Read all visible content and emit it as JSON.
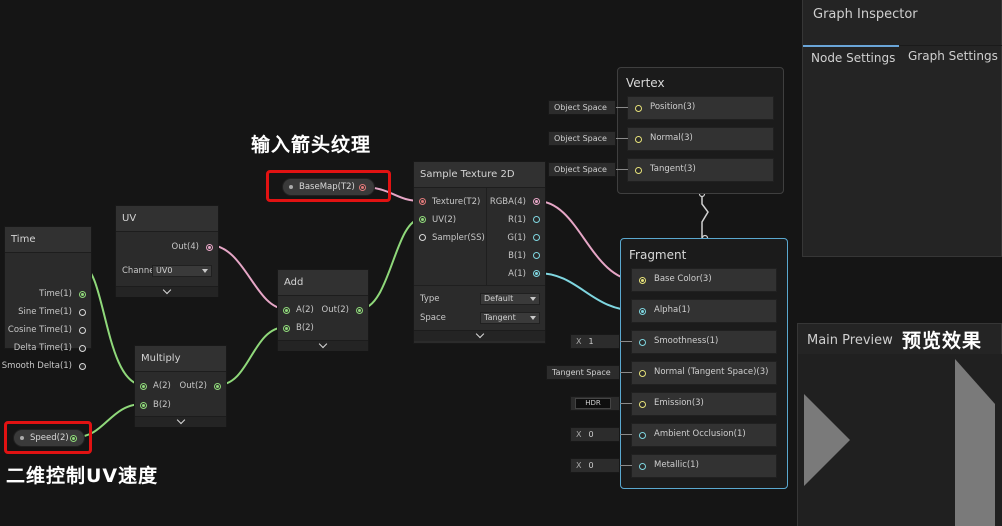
{
  "nodes": {
    "time": {
      "title": "Time",
      "outputs": [
        "Time(1)",
        "Sine Time(1)",
        "Cosine Time(1)",
        "Delta Time(1)",
        "Smooth Delta(1)"
      ]
    },
    "uv": {
      "title": "UV",
      "output": "Out(4)",
      "channel_label": "Channe",
      "channel_value": "UV0"
    },
    "multiply": {
      "title": "Multiply",
      "inputs": [
        "A(2)",
        "B(2)"
      ],
      "output": "Out(2)"
    },
    "add": {
      "title": "Add",
      "inputs": [
        "A(2)",
        "B(2)"
      ],
      "output": "Out(2)"
    },
    "sample": {
      "title": "Sample Texture 2D",
      "inputs": [
        "Texture(T2)",
        "UV(2)",
        "Sampler(SS)"
      ],
      "outputs": [
        "RGBA(4)",
        "R(1)",
        "G(1)",
        "B(1)",
        "A(1)"
      ],
      "type_label": "Type",
      "type_value": "Default",
      "space_label": "Space",
      "space_value": "Tangent"
    },
    "basemap": {
      "label": "BaseMap(T2)"
    },
    "speed": {
      "label": "Speed(2)"
    }
  },
  "vertex": {
    "title": "Vertex",
    "blocks": [
      {
        "label": "Position(3)",
        "chip": "Object Space"
      },
      {
        "label": "Normal(3)",
        "chip": "Object Space"
      },
      {
        "label": "Tangent(3)",
        "chip": "Object Space"
      }
    ]
  },
  "fragment": {
    "title": "Fragment",
    "blocks": [
      {
        "label": "Base Color(3)",
        "chip_x": "",
        "chip_val": ""
      },
      {
        "label": "Alpha(1)",
        "chip_x": "",
        "chip_val": ""
      },
      {
        "label": "Smoothness(1)",
        "chip_x": "X",
        "chip_val": "1"
      },
      {
        "label": "Normal (Tangent Space)(3)",
        "chip_x": "",
        "chip_val": "Tangent Space"
      },
      {
        "label": "Emission(3)",
        "chip_x": "",
        "chip_val": "HDR"
      },
      {
        "label": "Ambient Occlusion(1)",
        "chip_x": "X",
        "chip_val": "0"
      },
      {
        "label": "Metallic(1)",
        "chip_x": "X",
        "chip_val": "0"
      }
    ]
  },
  "inspector": {
    "title": "Graph Inspector",
    "tabs": [
      "Node Settings",
      "Graph Settings"
    ]
  },
  "preview": {
    "title": "Main Preview"
  },
  "annotations": {
    "texture_input": "输入箭头纹理",
    "speed_control": "二维控制UV速度",
    "preview_effect": "预览效果"
  },
  "colors": {
    "background": "#151515",
    "node": "#2b2b2b",
    "highlight_red": "#e11212",
    "fragment_border": "#5aa8cf",
    "wire_green": "#8fd87a",
    "wire_pink": "#e6a6c6",
    "wire_cyan": "#7fd6e0"
  }
}
